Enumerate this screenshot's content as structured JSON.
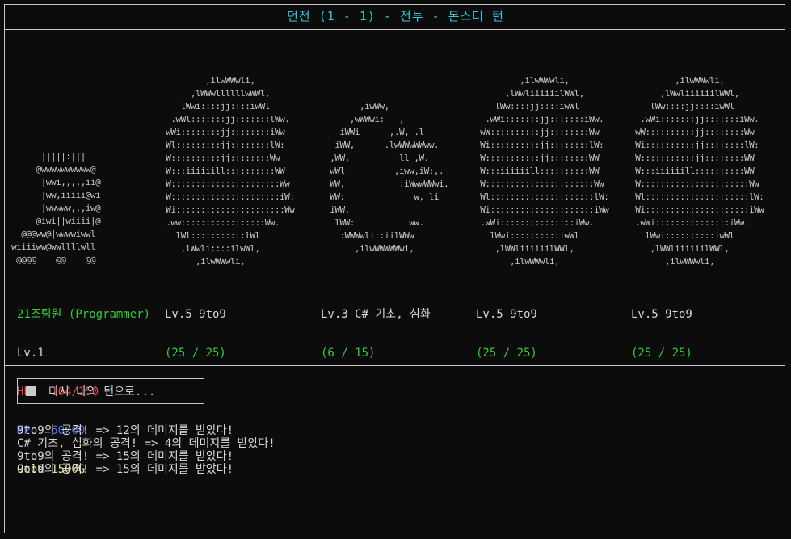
{
  "title": "던전 (1 - 1) - 전투 - 몬스터 턴",
  "player": {
    "name": "21조팀원 (Programmer)",
    "level": "Lv.1",
    "hp_label": "HP",
    "hp_value": "104/150",
    "mp_label": "MP",
    "mp_value": "60/60",
    "gold": "Gold 1500G",
    "art": "      |||||:|||\n     @wwwwwwwwww@\n      |wwi,,,,,ii@\n      |ww,iiiii@wi\n      |wwwww,,,iw@\n     @iwi||wiiii|@\n  @@@ww@|wwwwiwwl\nwiiiiww@wwllllwll\n @@@@    @@    @@"
  },
  "monsters": [
    {
      "name": "Lv.5 9to9",
      "count": "(25 / 25)",
      "art": "          ,ilwWWwli,\n       ,lWWwllllllwWWl,\n     lWwi::::jj::::iwWl\n   .wWl:::::::jj:::::::lWw.\n  wWi::::::::jj::::::::iWw\n  Wl:::::::::jj::::::::lW:\n  W::::::::::jj::::::::Ww\n  W:::iiiiiill::::::::::WW\n  W::::::::::::::::::::::Ww\n  W::::::::::::::::::::::iW:\n  Wi::::::::::::::::::::::Ww\n  .ww:::::::::::::::::Ww.\n    lWl:::::::::::lWl\n     ,lWwli::::ilwWl,\n        ,ilwWWwli,"
    },
    {
      "name": "Lv.3 C# 기초, 심화",
      "count": "(6 / 15)",
      "art": "\n\n        ,iwWw,\n      ,wWWwi:   ,\n    iWWi      ,.W, .l\n   iWW,      .lwWWwWWww.\n  ,WW,          ll ,W.\n  wWl          ,iww,iW:,.\n  WW,           :iWwwWWwi.\n  WW:              w, li\n  iWW.\n   lWW:           ww.\n    :WWWwli::iilWWw\n       ,ilwWWWWWwi,"
    },
    {
      "name": "Lv.5 9to9",
      "count": "(25 / 25)",
      "art": "          ,ilwWWwli,\n       ,lWwliiiiiilWWl,\n     lWw::::jj::::iwWl\n   .wWi:::::::jj:::::::iWw.\n  wW::::::::::jj::::::::Ww\n  Wi::::::::::jj::::::::lW:\n  W:::::::::::jj::::::::WW\n  W:::iiiiiill::::::::::WW\n  W::::::::::::::::::::::Ww\n  Wl:::::::::::::::::::::lW:\n  Wi:::::::::::::::::::::iWw\n  .wWi:::::::::::::::iWw.\n    lWwi::::::::::iwWl\n     ,lWWliiiiiilWWl,\n        ,ilwWWwli,"
    },
    {
      "name": "Lv.5 9to9",
      "count": "(25 / 25)",
      "art": "          ,ilwWWwli,\n       ,lWwliiiiiilWWl,\n     lWw::::jj::::iwWl\n   .wWi:::::::jj:::::::iWw.\n  wW::::::::::jj::::::::Ww\n  Wi::::::::::jj::::::::lW:\n  W:::::::::::jj::::::::WW\n  W:::iiiiiill::::::::::WW\n  W::::::::::::::::::::::Ww\n  Wl:::::::::::::::::::::lW:\n  Wi:::::::::::::::::::::iWw\n  .wWi:::::::::::::::iWw.\n    lWwi::::::::::iwWl\n     ,lWWliiiiiilWWl,\n        ,ilwWWwli,"
    }
  ],
  "button": {
    "label": "다시 나의 턴으로..."
  },
  "log": [
    "9to9의 공격! => 12의 데미지를 받았다!",
    "C# 기초, 심화의 공격! => 4의 데미지를 받았다!",
    "9to9의 공격! => 15의 데미지를 받았다!",
    "9to9의 공격! => 15의 데미지를 받았다!"
  ]
}
